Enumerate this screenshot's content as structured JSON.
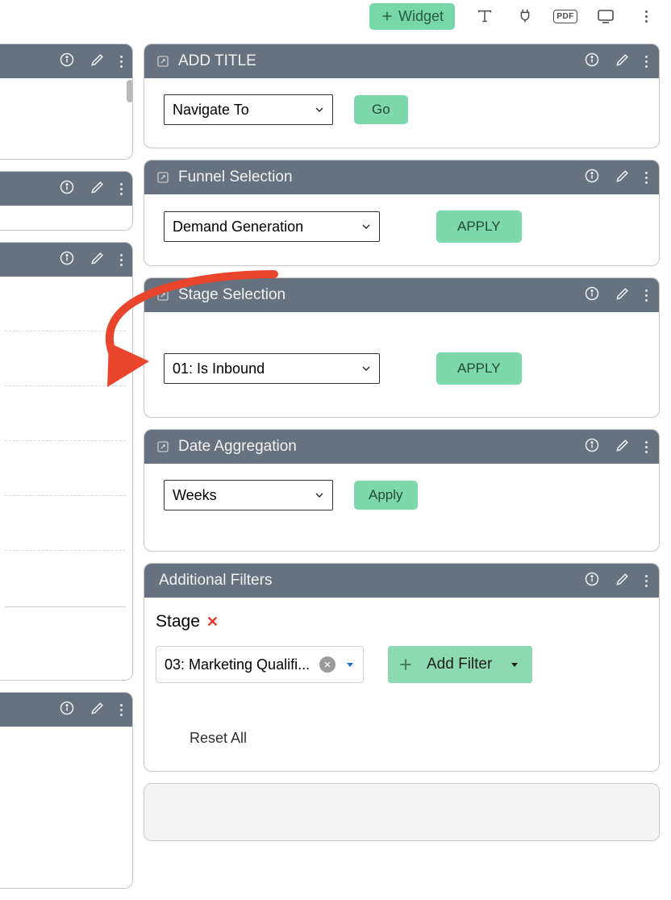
{
  "toolbar": {
    "widget_label": "Widget"
  },
  "cards": {
    "add_title": {
      "title": "ADD TITLE",
      "select_label": "Navigate To",
      "go_label": "Go"
    },
    "funnel": {
      "title": "Funnel Selection",
      "select_label": "Demand Generation",
      "apply_label": "APPLY"
    },
    "stage": {
      "title": "Stage Selection",
      "select_label": "01: Is Inbound",
      "apply_label": "APPLY"
    },
    "date_agg": {
      "title": "Date Aggregation",
      "select_label": "Weeks",
      "apply_label": "Apply"
    },
    "filters": {
      "title": "Additional Filters",
      "field_label": "Stage",
      "chip_value": "03: Marketing Qualifi...",
      "add_filter_label": "Add Filter",
      "reset_label": "Reset All"
    }
  }
}
